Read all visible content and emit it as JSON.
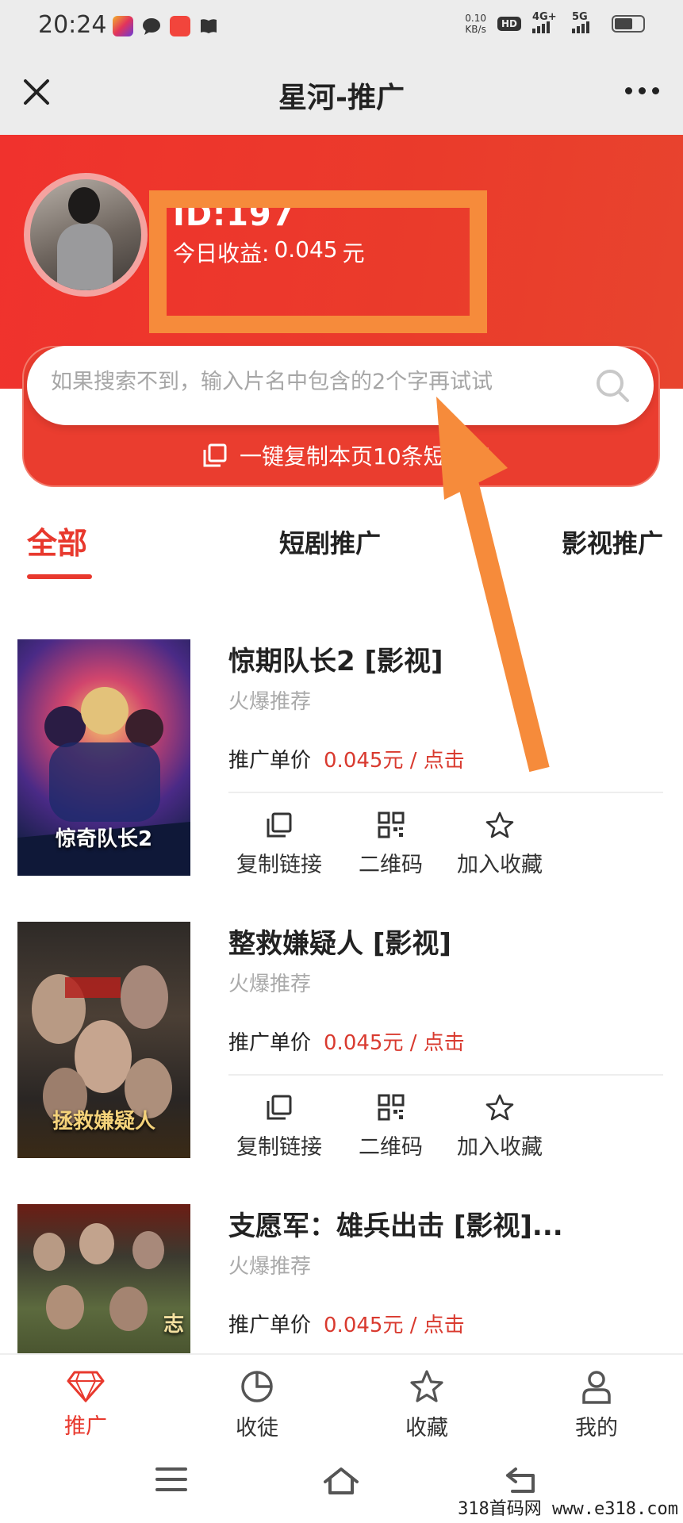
{
  "status_bar": {
    "time": "20:24",
    "net_speed_value": "0.10",
    "net_speed_unit": "KB/s",
    "hd_label": "HD",
    "signal_1": "4G+",
    "signal_2": "5G"
  },
  "nav": {
    "title": "星河-推广",
    "close_icon": "close-icon",
    "more_icon": "more-icon"
  },
  "profile": {
    "id_text": "ID:197",
    "earnings_label": "今日收益:",
    "earnings_value": "0.045",
    "earnings_unit": "元"
  },
  "search": {
    "placeholder": "如果搜索不到，输入片名中包含的2个字再试试"
  },
  "copy_all_label": "一键复制本页10条短链接",
  "tabs": [
    {
      "label": "全部",
      "active": true
    },
    {
      "label": "短剧推广",
      "active": false
    },
    {
      "label": "影视推广",
      "active": false
    }
  ],
  "items": [
    {
      "title": "惊期队长2 [影视]",
      "tag": "火爆推荐",
      "price_label": "推广单价",
      "price_value": "0.045元 / 点击",
      "poster_caption": "惊奇队长2",
      "actions": [
        "复制链接",
        "二维码",
        "加入收藏"
      ]
    },
    {
      "title": "整救嫌疑人 [影视]",
      "tag": "火爆推荐",
      "price_label": "推广单价",
      "price_value": "0.045元 / 点击",
      "poster_caption": "拯救嫌疑人",
      "actions": [
        "复制链接",
        "二维码",
        "加入收藏"
      ]
    },
    {
      "title": "支愿军：雄兵出击 [影视]...",
      "tag": "火爆推荐",
      "price_label": "推广单价",
      "price_value": "0.045元 / 点击",
      "poster_caption": "志",
      "actions": []
    }
  ],
  "bottom_tabs": [
    {
      "label": "推广",
      "icon": "diamond-icon",
      "active": true
    },
    {
      "label": "收徒",
      "icon": "pie-chart-icon",
      "active": false
    },
    {
      "label": "收藏",
      "icon": "star-icon",
      "active": false
    },
    {
      "label": "我的",
      "icon": "user-icon",
      "active": false
    }
  ],
  "watermark": "318首码网  www.e318.com",
  "colors": {
    "brand_red": "#e8392e",
    "highlight_orange": "#f68b3b"
  }
}
